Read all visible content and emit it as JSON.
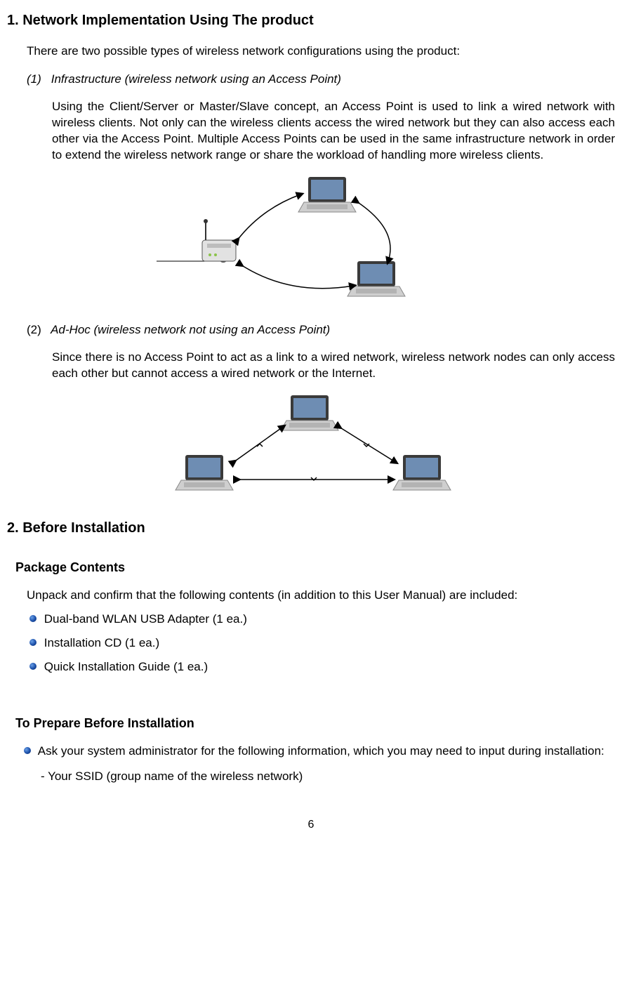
{
  "section1": {
    "heading": "1. Network Implementation Using The product",
    "intro": "There are two possible types of wireless network configurations using the product:",
    "item1": {
      "num": "(1)",
      "title": "Infrastructure (wireless network using an Access Point)",
      "body": "Using the Client/Server or Master/Slave concept, an Access Point is used to link a wired network with wireless clients. Not only can the wireless clients access the wired network but they can also access each other via the Access Point. Multiple Access Points can be used in the same infrastructure network in order to extend the wireless network range or share the workload of handling more wireless clients."
    },
    "item2": {
      "num": "(2)",
      "title": "Ad-Hoc (wireless network not using an Access Point)",
      "body": "Since there is no Access Point to act as a link to a wired network, wireless network nodes can only access each other but cannot access a wired network or the Internet."
    }
  },
  "section2": {
    "heading": "2. Before Installation",
    "package": {
      "subheading": "Package Contents",
      "intro": "Unpack and confirm that the following contents (in addition to this User Manual) are included:",
      "bullets": {
        "b1": "Dual-band WLAN USB Adapter (1 ea.)",
        "b2": "Installation CD (1 ea.)",
        "b3": "Quick Installation Guide (1 ea.)"
      }
    },
    "prepare": {
      "subheading": "To Prepare Before Installation",
      "bullet": "Ask your system administrator for the following information, which you may need to input during installation:",
      "dash1": "- Your SSID (group name of the wireless network)"
    }
  },
  "page_number": "6"
}
